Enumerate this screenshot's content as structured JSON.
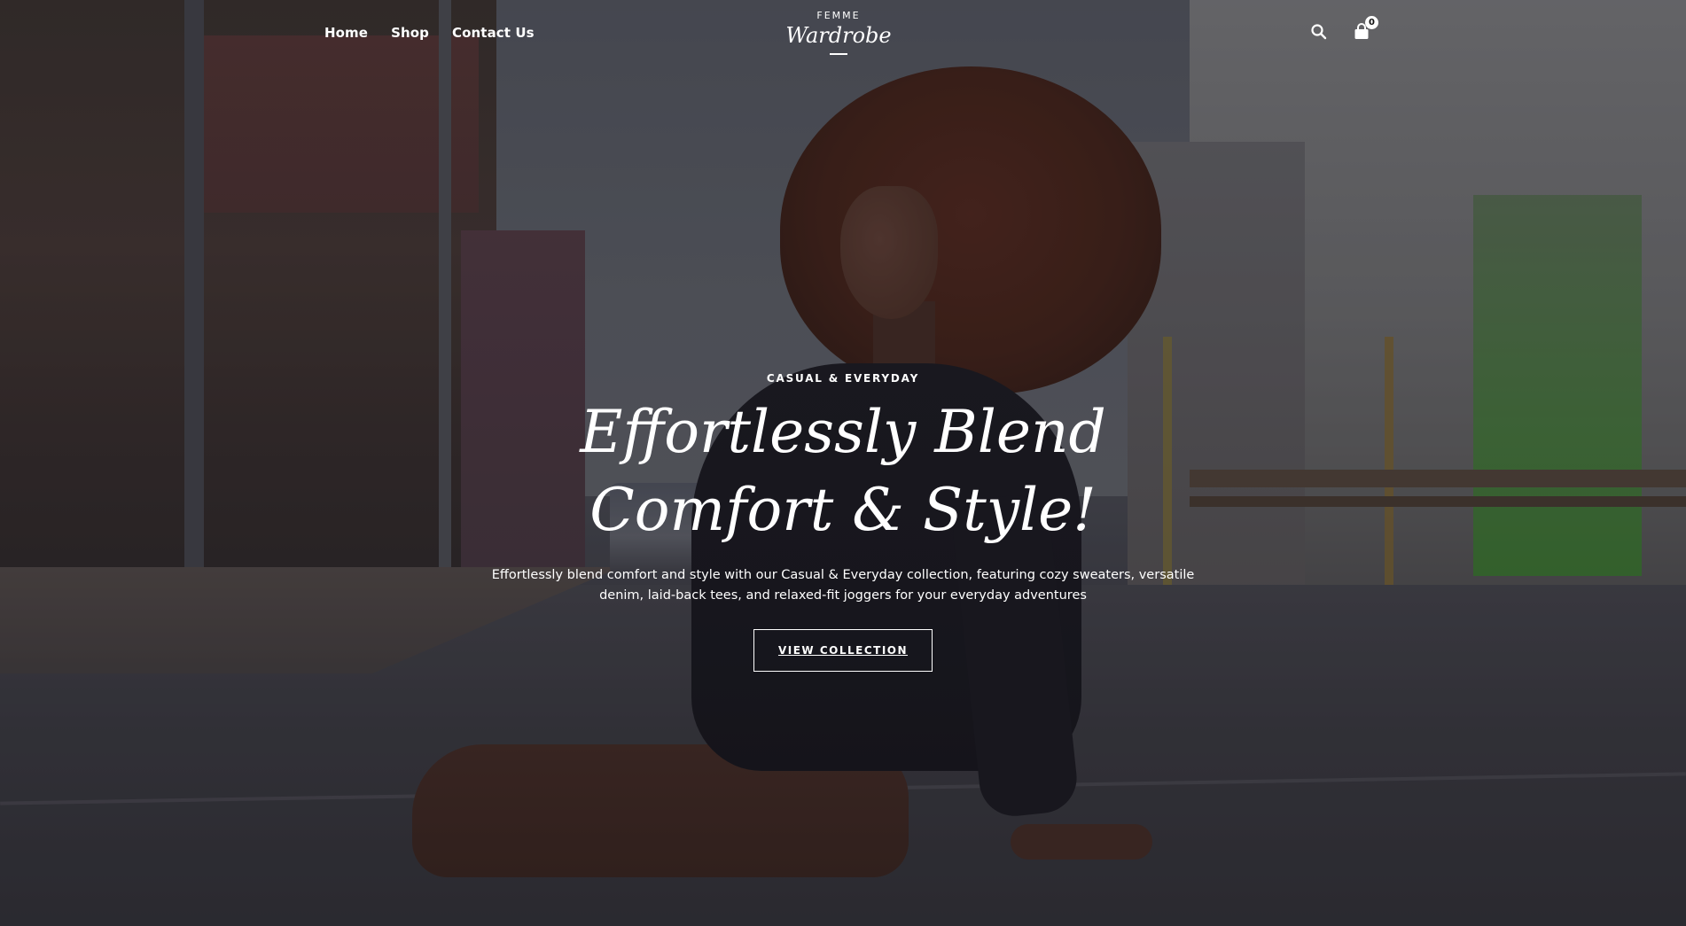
{
  "header": {
    "nav": [
      {
        "label": "Home"
      },
      {
        "label": "Shop"
      },
      {
        "label": "Contact Us"
      }
    ],
    "logo": {
      "small": "FEMME",
      "main": "Wardrobe"
    },
    "cart_count": "0",
    "icons": {
      "search": "search-icon",
      "cart": "shopping-bag-icon"
    }
  },
  "hero": {
    "eyebrow": "CASUAL & EVERYDAY",
    "headline": "Effortlessly Blend Comfort & Style!",
    "subtitle": "Effortlessly blend comfort and style with our Casual & Everyday collection, featuring cozy sweaters, versatile denim, laid-back tees, and relaxed-fit joggers for your everyday adventures",
    "cta_label": "VIEW COLLECTION"
  },
  "colors": {
    "text": "#ffffff",
    "overlay": "#14121a"
  }
}
